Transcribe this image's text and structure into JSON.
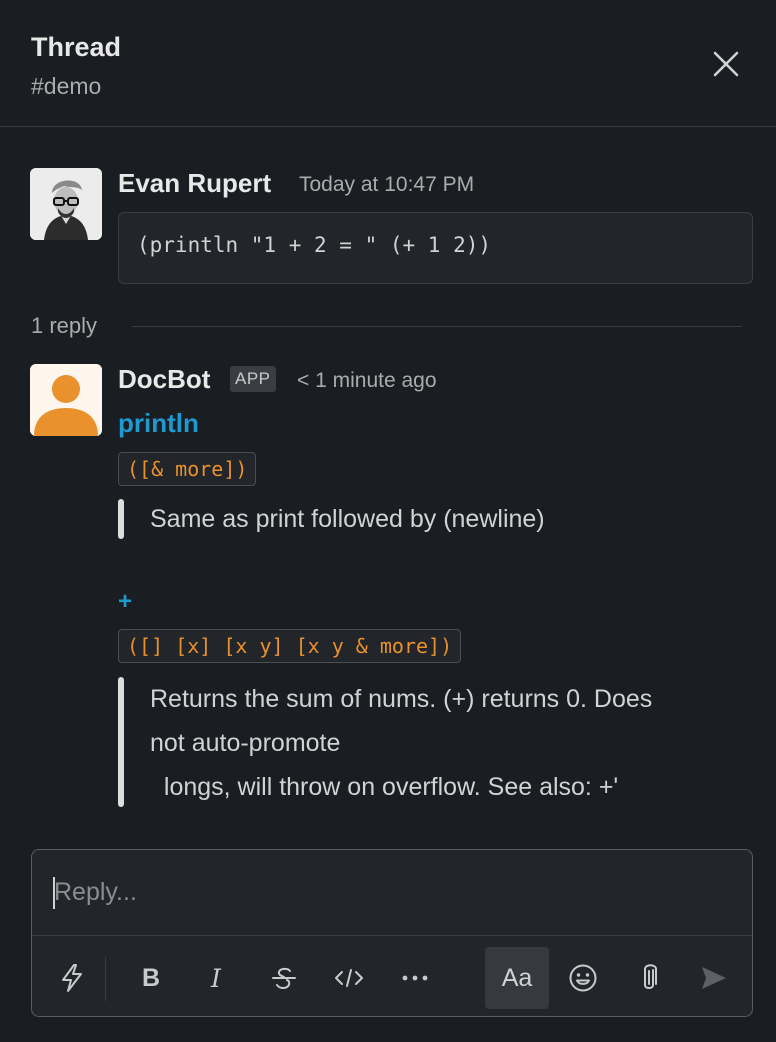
{
  "header": {
    "title": "Thread",
    "channel": "#demo"
  },
  "messages": [
    {
      "author": "Evan Rupert",
      "timestamp": "Today at 10:47 PM",
      "code": "(println \"1 + 2 = \" (+ 1 2))"
    },
    {
      "author": "DocBot",
      "badge": "APP",
      "timestamp": "< 1 minute ago",
      "docs": [
        {
          "name": "println",
          "signature": "([& more])",
          "description": [
            "Same as print followed by (newline)"
          ]
        },
        {
          "name": "+",
          "signature": "([] [x] [x y] [x y & more])",
          "description": [
            "Returns the sum of nums. (+) returns 0. Does",
            "not auto-promote",
            "  longs, will throw on overflow. See also: +'"
          ]
        }
      ]
    }
  ],
  "thread": {
    "reply_count": "1 reply"
  },
  "composer": {
    "placeholder": "Reply...",
    "format_toggle_label": "Aa"
  },
  "colors": {
    "background": "#1a1d21",
    "link": "#1d9bd1",
    "code_signature": "#e8912d",
    "bot_avatar": "#e8912d"
  }
}
